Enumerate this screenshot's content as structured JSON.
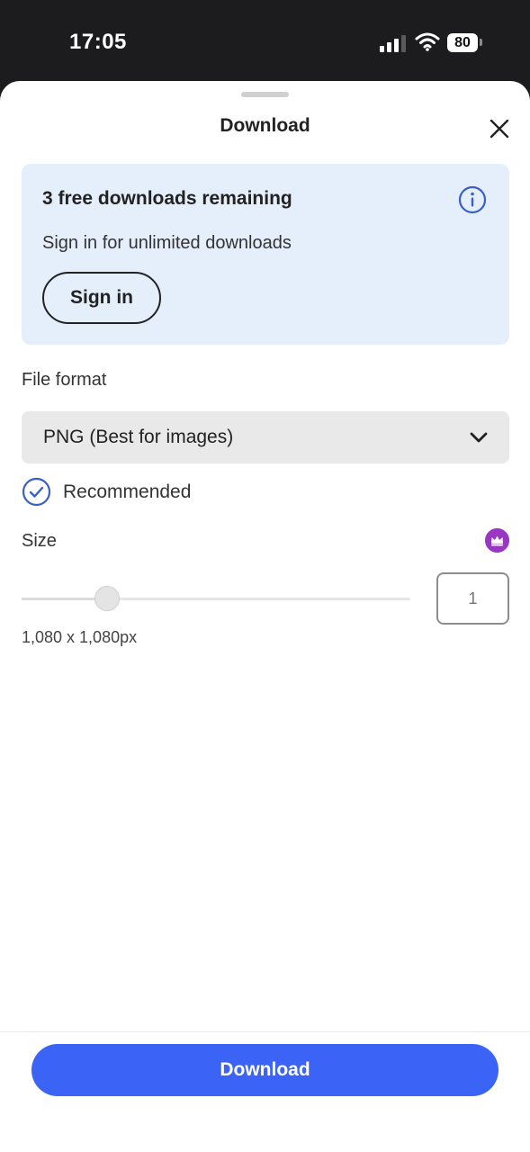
{
  "status_bar": {
    "time": "17:05",
    "battery": "80",
    "icons": [
      "signal-icon",
      "wifi-icon",
      "battery-icon"
    ]
  },
  "sheet": {
    "title": "Download",
    "close_icon": "close-icon"
  },
  "info_card": {
    "heading": "3 free downloads remaining",
    "subtitle": "Sign in for unlimited downloads",
    "signin_label": "Sign in",
    "info_icon": "info-icon",
    "background": "#e5effc"
  },
  "file_format": {
    "label": "File format",
    "selected": "PNG (Best for images)",
    "recommended_label": "Recommended",
    "icons": [
      "chevron-down-icon",
      "checkmark-circle-icon"
    ]
  },
  "size": {
    "label": "Size",
    "premium_icon": "crown-icon",
    "slider_level": 0.22,
    "quantity_value": "1",
    "dimensions": "1,080 x 1,080px"
  },
  "footer": {
    "download_label": "Download",
    "accent_color": "#3b63f5"
  }
}
